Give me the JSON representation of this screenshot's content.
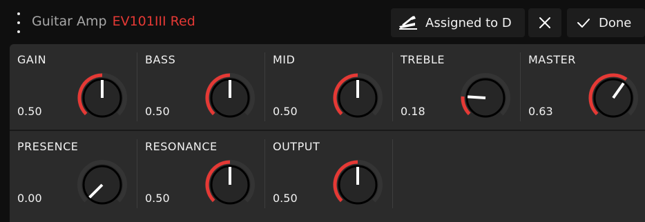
{
  "header": {
    "title_prefix": "Guitar Amp",
    "title_model": "EV101III Red",
    "assign_label": "Assigned to D",
    "done_label": "Done"
  },
  "knobs": [
    {
      "name": "GAIN",
      "value": "0.50",
      "level": 0.5
    },
    {
      "name": "BASS",
      "value": "0.50",
      "level": 0.5
    },
    {
      "name": "MID",
      "value": "0.50",
      "level": 0.5
    },
    {
      "name": "TREBLE",
      "value": "0.18",
      "level": 0.18
    },
    {
      "name": "MASTER",
      "value": "0.63",
      "level": 0.63
    },
    {
      "name": "PRESENCE",
      "value": "0.00",
      "level": 0.0
    },
    {
      "name": "RESONANCE",
      "value": "0.50",
      "level": 0.5
    },
    {
      "name": "OUTPUT",
      "value": "0.50",
      "level": 0.5
    }
  ],
  "colors": {
    "accent": "#e53935",
    "panel": "#2b2b2b",
    "background": "#0f0f0f"
  },
  "icons": {
    "menu": "kebab-menu-icon",
    "assign": "pedal-switch-icon",
    "close": "close-icon",
    "done": "checkmark-icon"
  }
}
